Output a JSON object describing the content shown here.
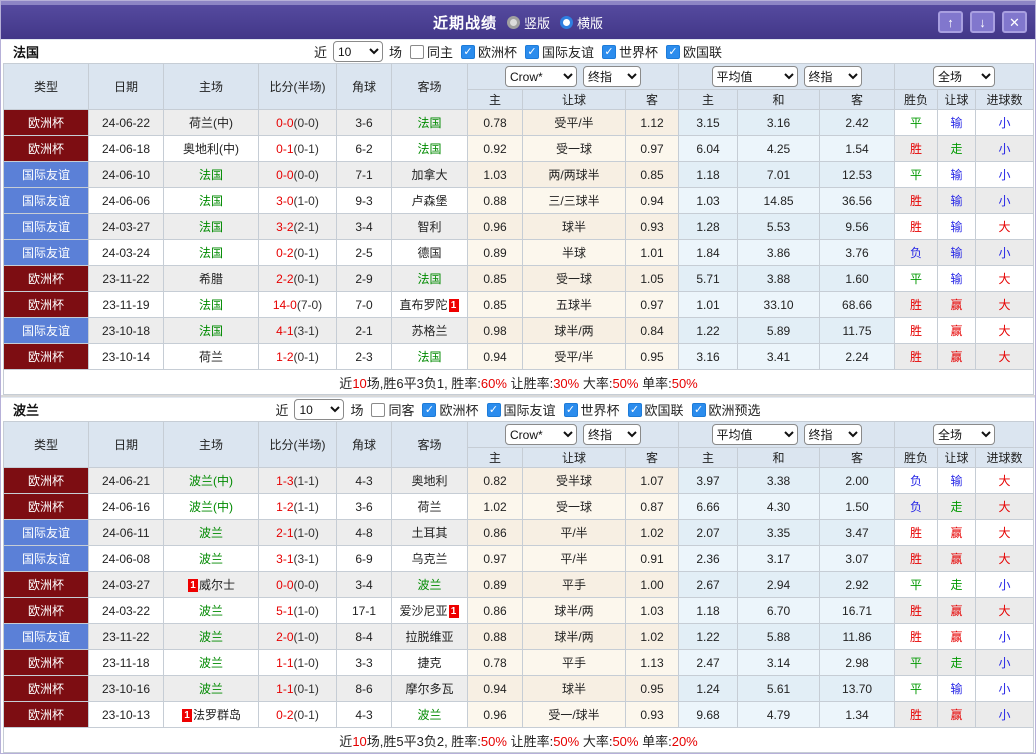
{
  "titlebar": {
    "title": "近期战绩",
    "view_radios": [
      {
        "label": "竖版",
        "selected": false
      },
      {
        "label": "横版",
        "selected": true
      }
    ],
    "window_buttons": {
      "up": "↑",
      "down": "↓",
      "close": "✕"
    }
  },
  "columns": {
    "static": [
      "类型",
      "日期",
      "主场",
      "比分(半场)",
      "角球",
      "客场"
    ],
    "group1": {
      "selects": [
        "Crow*",
        "终指"
      ],
      "sub": [
        "主",
        "让球",
        "客"
      ]
    },
    "group2": {
      "selects": [
        "平均值",
        "终指"
      ],
      "sub": [
        "主",
        "和",
        "客"
      ]
    },
    "group3": {
      "selects": [
        "全场"
      ],
      "sub": [
        "胜负",
        "让球",
        "进球数"
      ]
    }
  },
  "type_styles": {
    "欧洲杯": {
      "bg": "#7d0d12"
    },
    "国际友谊": {
      "bg": "#5b80d7"
    }
  },
  "result_colors": {
    "胜": "#e60000",
    "赢": "#e60000",
    "大": "#e60000",
    "平": "#009900",
    "走": "#009900",
    "负": "#2626e6",
    "输": "#2626e6",
    "小": "#2626e6"
  },
  "sections": [
    {
      "team": "法国",
      "filter": {
        "near_label": "近",
        "count": "10",
        "games_label": "场",
        "same": {
          "label": "同主",
          "checked": false
        },
        "comps": [
          {
            "label": "欧洲杯",
            "checked": true
          },
          {
            "label": "国际友谊",
            "checked": true
          },
          {
            "label": "世界杯",
            "checked": true
          },
          {
            "label": "欧国联",
            "checked": true
          }
        ]
      },
      "rows": [
        {
          "type": "欧洲杯",
          "date": "24-06-22",
          "home": {
            "name": "荷兰(中)",
            "green": false,
            "redcard": false
          },
          "score": "0-0",
          "half": "(0-0)",
          "corner": "3-6",
          "away": {
            "name": "法国",
            "green": true,
            "redcard": false
          },
          "odds": [
            "0.78",
            "受平/半",
            "1.12"
          ],
          "avg": [
            "3.15",
            "3.16",
            "2.42"
          ],
          "result": [
            "平",
            "输",
            "小"
          ]
        },
        {
          "type": "欧洲杯",
          "date": "24-06-18",
          "home": {
            "name": "奥地利(中)",
            "green": false,
            "redcard": false
          },
          "score": "0-1",
          "half": "(0-1)",
          "corner": "6-2",
          "away": {
            "name": "法国",
            "green": true,
            "redcard": false
          },
          "odds": [
            "0.92",
            "受一球",
            "0.97"
          ],
          "avg": [
            "6.04",
            "4.25",
            "1.54"
          ],
          "result": [
            "胜",
            "走",
            "小"
          ]
        },
        {
          "type": "国际友谊",
          "date": "24-06-10",
          "home": {
            "name": "法国",
            "green": true,
            "redcard": false
          },
          "score": "0-0",
          "half": "(0-0)",
          "corner": "7-1",
          "away": {
            "name": "加拿大",
            "green": false,
            "redcard": false
          },
          "odds": [
            "1.03",
            "两/两球半",
            "0.85"
          ],
          "avg": [
            "1.18",
            "7.01",
            "12.53"
          ],
          "result": [
            "平",
            "输",
            "小"
          ]
        },
        {
          "type": "国际友谊",
          "date": "24-06-06",
          "home": {
            "name": "法国",
            "green": true,
            "redcard": false
          },
          "score": "3-0",
          "half": "(1-0)",
          "corner": "9-3",
          "away": {
            "name": "卢森堡",
            "green": false,
            "redcard": false
          },
          "odds": [
            "0.88",
            "三/三球半",
            "0.94"
          ],
          "avg": [
            "1.03",
            "14.85",
            "36.56"
          ],
          "result": [
            "胜",
            "输",
            "小"
          ]
        },
        {
          "type": "国际友谊",
          "date": "24-03-27",
          "home": {
            "name": "法国",
            "green": true,
            "redcard": false
          },
          "score": "3-2",
          "half": "(2-1)",
          "corner": "3-4",
          "away": {
            "name": "智利",
            "green": false,
            "redcard": false
          },
          "odds": [
            "0.96",
            "球半",
            "0.93"
          ],
          "avg": [
            "1.28",
            "5.53",
            "9.56"
          ],
          "result": [
            "胜",
            "输",
            "大"
          ]
        },
        {
          "type": "国际友谊",
          "date": "24-03-24",
          "home": {
            "name": "法国",
            "green": true,
            "redcard": false
          },
          "score": "0-2",
          "half": "(0-1)",
          "corner": "2-5",
          "away": {
            "name": "德国",
            "green": false,
            "redcard": false
          },
          "odds": [
            "0.89",
            "半球",
            "1.01"
          ],
          "avg": [
            "1.84",
            "3.86",
            "3.76"
          ],
          "result": [
            "负",
            "输",
            "小"
          ]
        },
        {
          "type": "欧洲杯",
          "date": "23-11-22",
          "home": {
            "name": "希腊",
            "green": false,
            "redcard": false
          },
          "score": "2-2",
          "half": "(0-1)",
          "corner": "2-9",
          "away": {
            "name": "法国",
            "green": true,
            "redcard": false
          },
          "odds": [
            "0.85",
            "受一球",
            "1.05"
          ],
          "avg": [
            "5.71",
            "3.88",
            "1.60"
          ],
          "result": [
            "平",
            "输",
            "大"
          ]
        },
        {
          "type": "欧洲杯",
          "date": "23-11-19",
          "home": {
            "name": "法国",
            "green": true,
            "redcard": false
          },
          "score": "14-0",
          "half": "(7-0)",
          "corner": "7-0",
          "away": {
            "name": "直布罗陀",
            "green": false,
            "redcard": true
          },
          "odds": [
            "0.85",
            "五球半",
            "0.97"
          ],
          "avg": [
            "1.01",
            "33.10",
            "68.66"
          ],
          "result": [
            "胜",
            "赢",
            "大"
          ]
        },
        {
          "type": "国际友谊",
          "date": "23-10-18",
          "home": {
            "name": "法国",
            "green": true,
            "redcard": false
          },
          "score": "4-1",
          "half": "(3-1)",
          "corner": "2-1",
          "away": {
            "name": "苏格兰",
            "green": false,
            "redcard": false
          },
          "odds": [
            "0.98",
            "球半/两",
            "0.84"
          ],
          "avg": [
            "1.22",
            "5.89",
            "11.75"
          ],
          "result": [
            "胜",
            "赢",
            "大"
          ]
        },
        {
          "type": "欧洲杯",
          "date": "23-10-14",
          "home": {
            "name": "荷兰",
            "green": false,
            "redcard": false
          },
          "score": "1-2",
          "half": "(0-1)",
          "corner": "2-3",
          "away": {
            "name": "法国",
            "green": true,
            "redcard": false
          },
          "odds": [
            "0.94",
            "受平/半",
            "0.95"
          ],
          "avg": [
            "3.16",
            "3.41",
            "2.24"
          ],
          "result": [
            "胜",
            "赢",
            "大"
          ]
        }
      ],
      "summary": [
        {
          "text": "近",
          "red": false
        },
        {
          "text": "10",
          "red": true
        },
        {
          "text": "场,胜6平3负1, 胜率:",
          "red": false
        },
        {
          "text": "60%",
          "red": true
        },
        {
          "text": " 让胜率:",
          "red": false
        },
        {
          "text": "30%",
          "red": true
        },
        {
          "text": " 大率:",
          "red": false
        },
        {
          "text": "50%",
          "red": true
        },
        {
          "text": " 单率:",
          "red": false
        },
        {
          "text": "50%",
          "red": true
        }
      ]
    },
    {
      "team": "波兰",
      "filter": {
        "near_label": "近",
        "count": "10",
        "games_label": "场",
        "same": {
          "label": "同客",
          "checked": false
        },
        "comps": [
          {
            "label": "欧洲杯",
            "checked": true
          },
          {
            "label": "国际友谊",
            "checked": true
          },
          {
            "label": "世界杯",
            "checked": true
          },
          {
            "label": "欧国联",
            "checked": true
          },
          {
            "label": "欧洲预选",
            "checked": true
          }
        ]
      },
      "rows": [
        {
          "type": "欧洲杯",
          "date": "24-06-21",
          "home": {
            "name": "波兰(中)",
            "green": true,
            "redcard": false
          },
          "score": "1-3",
          "half": "(1-1)",
          "corner": "4-3",
          "away": {
            "name": "奥地利",
            "green": false,
            "redcard": false
          },
          "odds": [
            "0.82",
            "受半球",
            "1.07"
          ],
          "avg": [
            "3.97",
            "3.38",
            "2.00"
          ],
          "result": [
            "负",
            "输",
            "大"
          ]
        },
        {
          "type": "欧洲杯",
          "date": "24-06-16",
          "home": {
            "name": "波兰(中)",
            "green": true,
            "redcard": false
          },
          "score": "1-2",
          "half": "(1-1)",
          "corner": "3-6",
          "away": {
            "name": "荷兰",
            "green": false,
            "redcard": false
          },
          "odds": [
            "1.02",
            "受一球",
            "0.87"
          ],
          "avg": [
            "6.66",
            "4.30",
            "1.50"
          ],
          "result": [
            "负",
            "走",
            "大"
          ]
        },
        {
          "type": "国际友谊",
          "date": "24-06-11",
          "home": {
            "name": "波兰",
            "green": true,
            "redcard": false
          },
          "score": "2-1",
          "half": "(1-0)",
          "corner": "4-8",
          "away": {
            "name": "土耳其",
            "green": false,
            "redcard": false
          },
          "odds": [
            "0.86",
            "平/半",
            "1.02"
          ],
          "avg": [
            "2.07",
            "3.35",
            "3.47"
          ],
          "result": [
            "胜",
            "赢",
            "大"
          ]
        },
        {
          "type": "国际友谊",
          "date": "24-06-08",
          "home": {
            "name": "波兰",
            "green": true,
            "redcard": false
          },
          "score": "3-1",
          "half": "(3-1)",
          "corner": "6-9",
          "away": {
            "name": "乌克兰",
            "green": false,
            "redcard": false
          },
          "odds": [
            "0.97",
            "平/半",
            "0.91"
          ],
          "avg": [
            "2.36",
            "3.17",
            "3.07"
          ],
          "result": [
            "胜",
            "赢",
            "大"
          ]
        },
        {
          "type": "欧洲杯",
          "date": "24-03-27",
          "home": {
            "name": "威尔士",
            "green": false,
            "redcard": true
          },
          "score": "0-0",
          "half": "(0-0)",
          "corner": "3-4",
          "away": {
            "name": "波兰",
            "green": true,
            "redcard": false
          },
          "odds": [
            "0.89",
            "平手",
            "1.00"
          ],
          "avg": [
            "2.67",
            "2.94",
            "2.92"
          ],
          "result": [
            "平",
            "走",
            "小"
          ]
        },
        {
          "type": "欧洲杯",
          "date": "24-03-22",
          "home": {
            "name": "波兰",
            "green": true,
            "redcard": false
          },
          "score": "5-1",
          "half": "(1-0)",
          "corner": "17-1",
          "away": {
            "name": "爱沙尼亚",
            "green": false,
            "redcard": true
          },
          "odds": [
            "0.86",
            "球半/两",
            "1.03"
          ],
          "avg": [
            "1.18",
            "6.70",
            "16.71"
          ],
          "result": [
            "胜",
            "赢",
            "大"
          ]
        },
        {
          "type": "国际友谊",
          "date": "23-11-22",
          "home": {
            "name": "波兰",
            "green": true,
            "redcard": false
          },
          "score": "2-0",
          "half": "(1-0)",
          "corner": "8-4",
          "away": {
            "name": "拉脱维亚",
            "green": false,
            "redcard": false
          },
          "odds": [
            "0.88",
            "球半/两",
            "1.02"
          ],
          "avg": [
            "1.22",
            "5.88",
            "11.86"
          ],
          "result": [
            "胜",
            "赢",
            "小"
          ]
        },
        {
          "type": "欧洲杯",
          "date": "23-11-18",
          "home": {
            "name": "波兰",
            "green": true,
            "redcard": false
          },
          "score": "1-1",
          "half": "(1-0)",
          "corner": "3-3",
          "away": {
            "name": "捷克",
            "green": false,
            "redcard": false
          },
          "odds": [
            "0.78",
            "平手",
            "1.13"
          ],
          "avg": [
            "2.47",
            "3.14",
            "2.98"
          ],
          "result": [
            "平",
            "走",
            "小"
          ]
        },
        {
          "type": "欧洲杯",
          "date": "23-10-16",
          "home": {
            "name": "波兰",
            "green": true,
            "redcard": false
          },
          "score": "1-1",
          "half": "(0-1)",
          "corner": "8-6",
          "away": {
            "name": "摩尔多瓦",
            "green": false,
            "redcard": false
          },
          "odds": [
            "0.94",
            "球半",
            "0.95"
          ],
          "avg": [
            "1.24",
            "5.61",
            "13.70"
          ],
          "result": [
            "平",
            "输",
            "小"
          ]
        },
        {
          "type": "欧洲杯",
          "date": "23-10-13",
          "home": {
            "name": "法罗群岛",
            "green": false,
            "redcard": true
          },
          "score": "0-2",
          "half": "(0-1)",
          "corner": "4-3",
          "away": {
            "name": "波兰",
            "green": true,
            "redcard": false
          },
          "odds": [
            "0.96",
            "受一/球半",
            "0.93"
          ],
          "avg": [
            "9.68",
            "4.79",
            "1.34"
          ],
          "result": [
            "胜",
            "赢",
            "小"
          ]
        }
      ],
      "summary": [
        {
          "text": "近",
          "red": false
        },
        {
          "text": "10",
          "red": true
        },
        {
          "text": "场,胜5平3负2, 胜率:",
          "red": false
        },
        {
          "text": "50%",
          "red": true
        },
        {
          "text": " 让胜率:",
          "red": false
        },
        {
          "text": "50%",
          "red": true
        },
        {
          "text": " 大率:",
          "red": false
        },
        {
          "text": "50%",
          "red": true
        },
        {
          "text": " 单率:",
          "red": false
        },
        {
          "text": "20%",
          "red": true
        }
      ]
    }
  ]
}
